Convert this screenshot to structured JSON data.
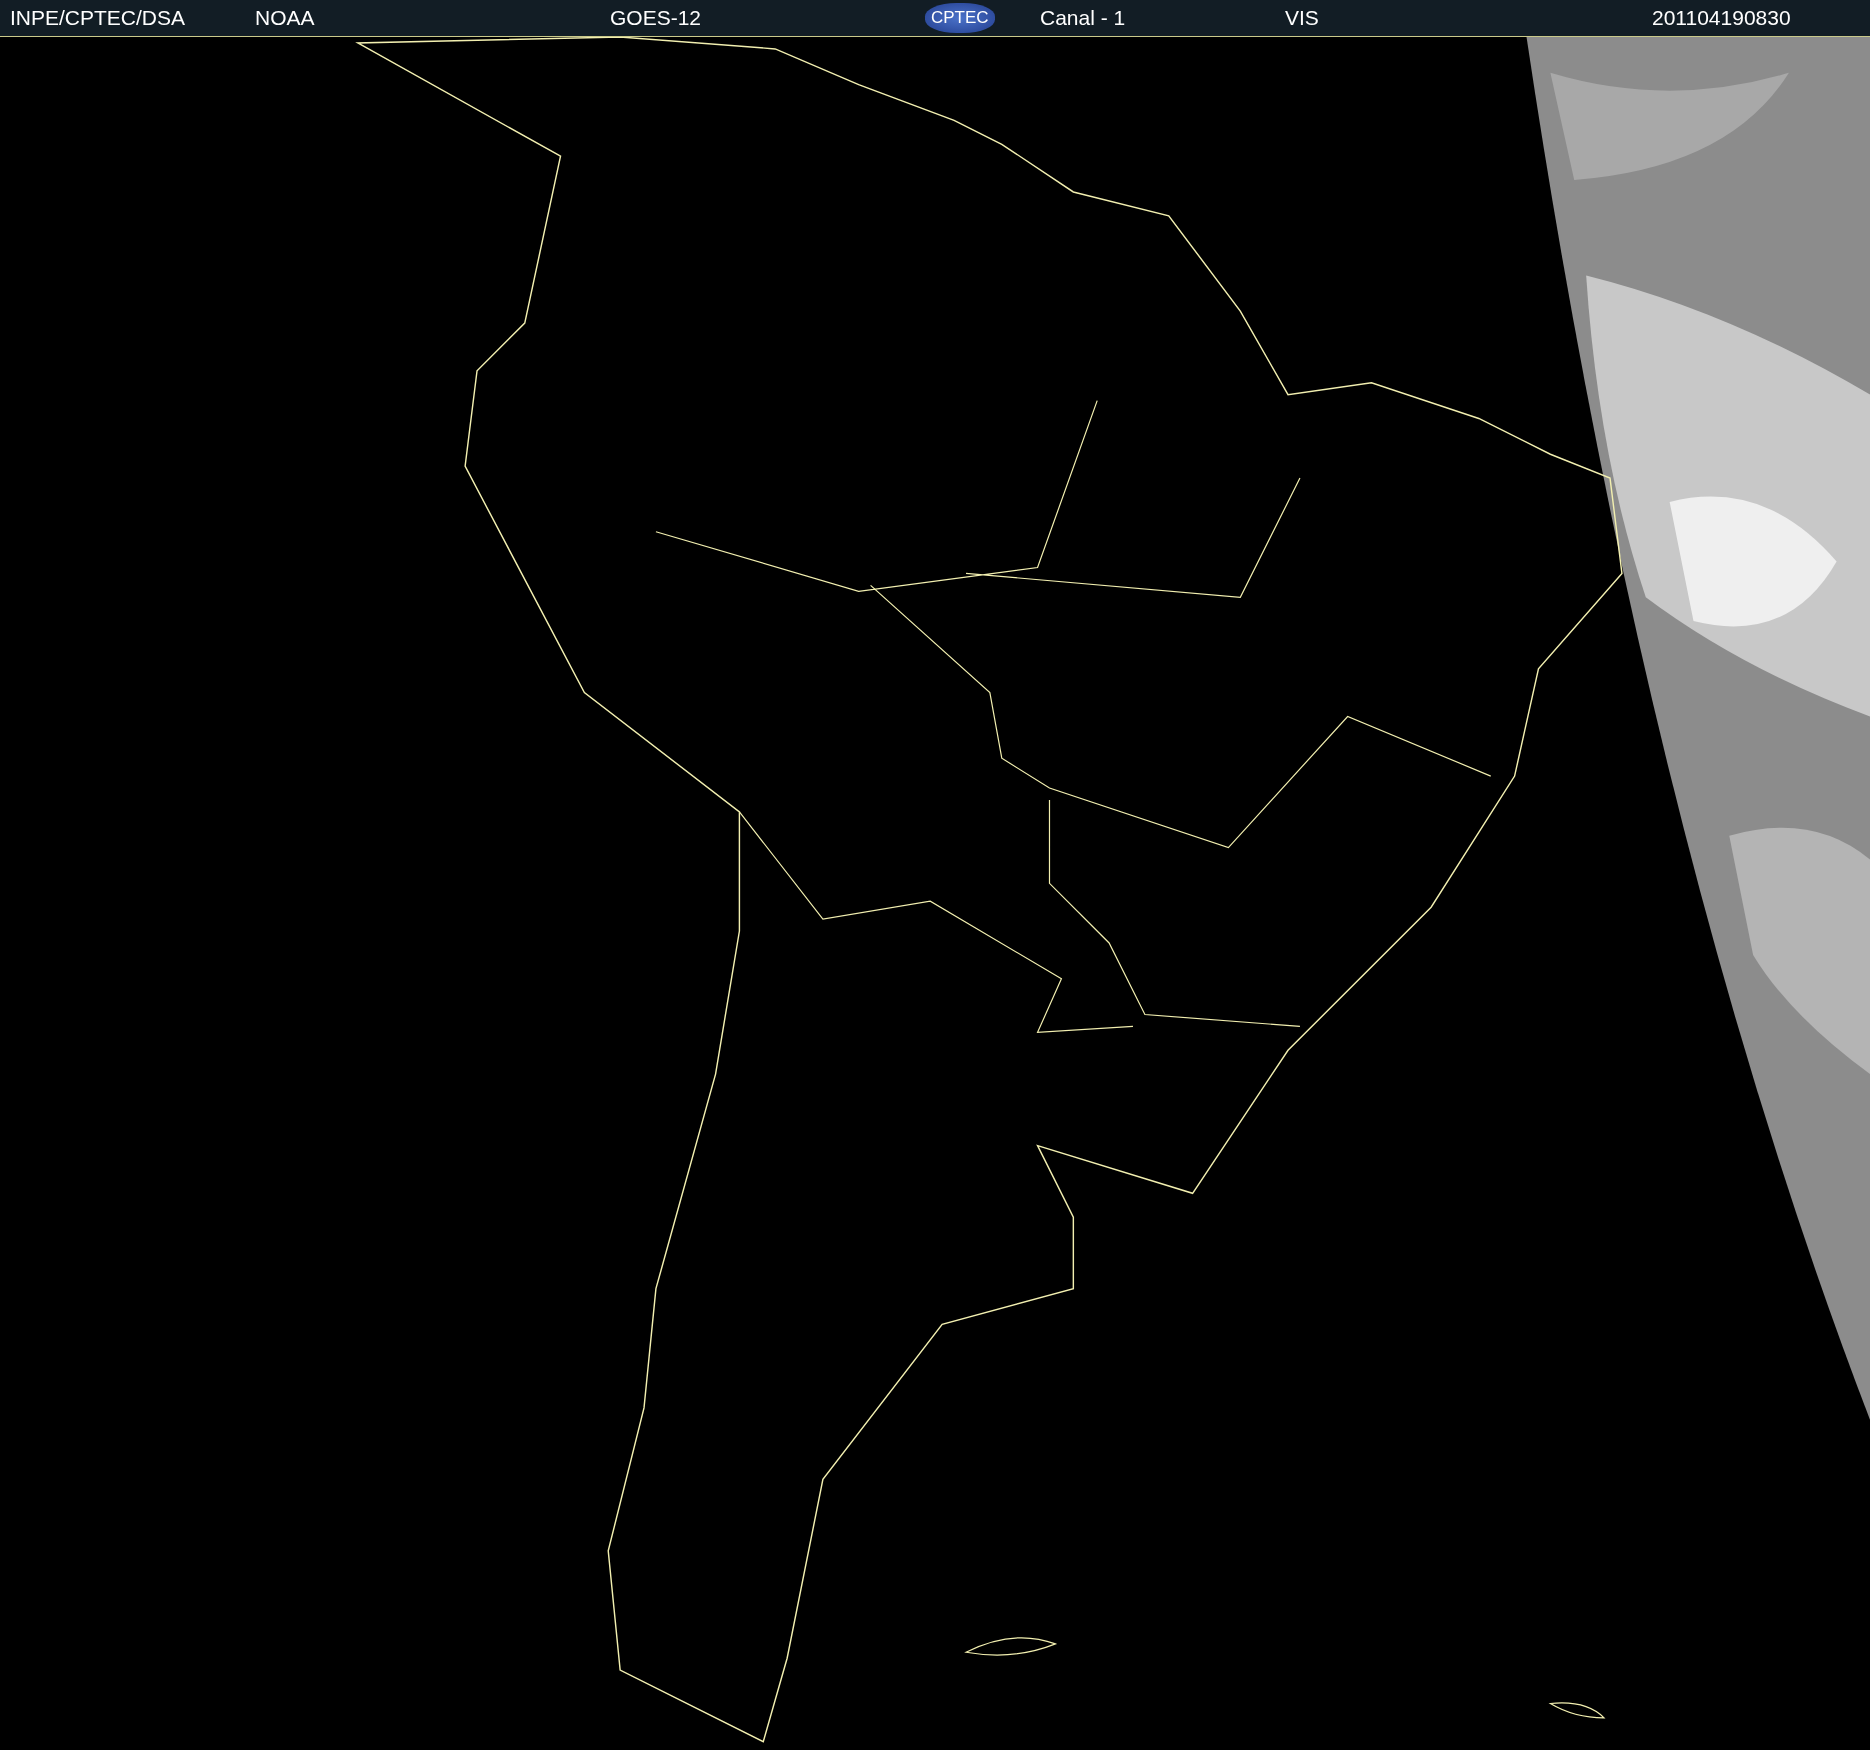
{
  "header": {
    "items": [
      {
        "kind": "text",
        "text": "INPE/CPTEC/DSA"
      },
      {
        "kind": "text",
        "text": "NOAA"
      },
      {
        "kind": "text",
        "text": "GOES-12"
      },
      {
        "kind": "logo",
        "text": "CPTEC"
      },
      {
        "kind": "text",
        "text": "Canal - 1"
      },
      {
        "kind": "text",
        "text": "VIS"
      },
      {
        "kind": "text",
        "text": "201104190830"
      }
    ]
  }
}
